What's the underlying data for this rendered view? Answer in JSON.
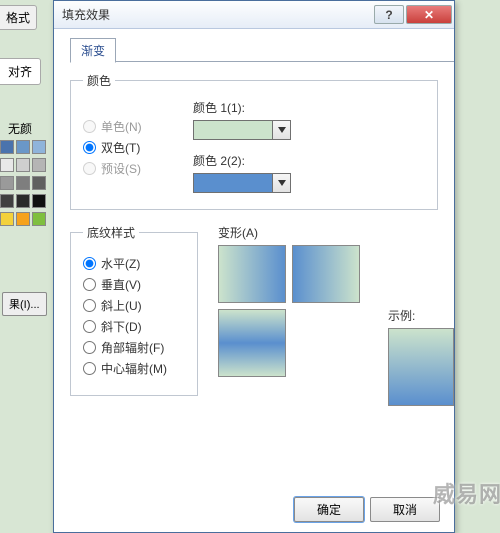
{
  "parent": {
    "title_fragment": "格式",
    "tab_align": "对齐",
    "no_color_label": "无颜",
    "btn_fill": "果(I)...",
    "palette_rows": [
      [
        "#4a73ad",
        "#6a97c8",
        "#8fb4db"
      ],
      [
        "#e8e8e8",
        "#cfcfcf",
        "#b5b5b5"
      ],
      [
        "#9a9a9a",
        "#7e7e7e",
        "#606060"
      ],
      [
        "#404040",
        "#2a2a2a",
        "#111111"
      ],
      [
        "#f3d13b",
        "#f6a21c",
        "#7fbf3f"
      ]
    ]
  },
  "dialog": {
    "title": "填充效果",
    "tab_gradient": "渐变",
    "group_color": "颜色",
    "radio_single": "单色(N)",
    "radio_two": "双色(T)",
    "radio_preset": "预设(S)",
    "label_color1": "颜色 1(1):",
    "label_color2": "颜色 2(2):",
    "color1": "#cce3cc",
    "color2": "#5a8fce",
    "group_pattern": "底纹样式",
    "radios_pattern": [
      "水平(Z)",
      "垂直(V)",
      "斜上(U)",
      "斜下(D)",
      "角部辐射(F)",
      "中心辐射(M)"
    ],
    "label_variant": "变形(A)",
    "label_sample": "示例:",
    "btn_ok": "确定",
    "btn_cancel": "取消"
  },
  "icons": {
    "help": "?",
    "close": "✕",
    "chevron": "▾"
  }
}
